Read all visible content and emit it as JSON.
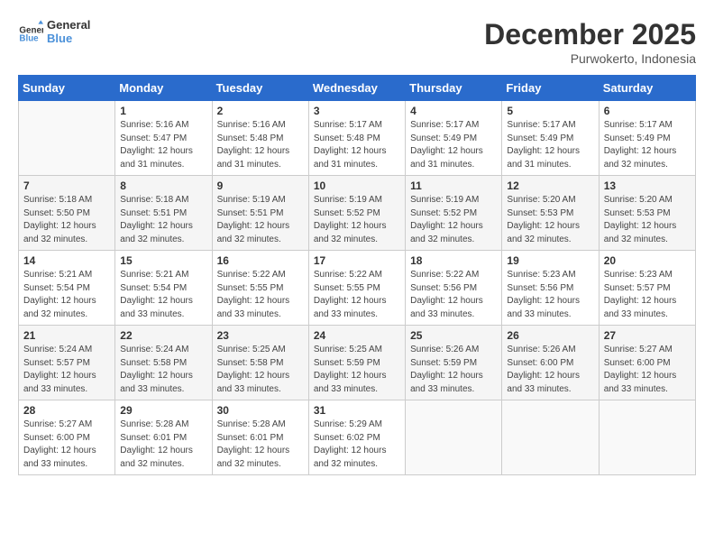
{
  "logo": {
    "line1": "General",
    "line2": "Blue"
  },
  "title": "December 2025",
  "location": "Purwokerto, Indonesia",
  "weekdays": [
    "Sunday",
    "Monday",
    "Tuesday",
    "Wednesday",
    "Thursday",
    "Friday",
    "Saturday"
  ],
  "weeks": [
    [
      {
        "day": "",
        "sunrise": "",
        "sunset": "",
        "daylight": ""
      },
      {
        "day": "1",
        "sunrise": "Sunrise: 5:16 AM",
        "sunset": "Sunset: 5:47 PM",
        "daylight": "Daylight: 12 hours and 31 minutes."
      },
      {
        "day": "2",
        "sunrise": "Sunrise: 5:16 AM",
        "sunset": "Sunset: 5:48 PM",
        "daylight": "Daylight: 12 hours and 31 minutes."
      },
      {
        "day": "3",
        "sunrise": "Sunrise: 5:17 AM",
        "sunset": "Sunset: 5:48 PM",
        "daylight": "Daylight: 12 hours and 31 minutes."
      },
      {
        "day": "4",
        "sunrise": "Sunrise: 5:17 AM",
        "sunset": "Sunset: 5:49 PM",
        "daylight": "Daylight: 12 hours and 31 minutes."
      },
      {
        "day": "5",
        "sunrise": "Sunrise: 5:17 AM",
        "sunset": "Sunset: 5:49 PM",
        "daylight": "Daylight: 12 hours and 31 minutes."
      },
      {
        "day": "6",
        "sunrise": "Sunrise: 5:17 AM",
        "sunset": "Sunset: 5:49 PM",
        "daylight": "Daylight: 12 hours and 32 minutes."
      }
    ],
    [
      {
        "day": "7",
        "sunrise": "Sunrise: 5:18 AM",
        "sunset": "Sunset: 5:50 PM",
        "daylight": "Daylight: 12 hours and 32 minutes."
      },
      {
        "day": "8",
        "sunrise": "Sunrise: 5:18 AM",
        "sunset": "Sunset: 5:51 PM",
        "daylight": "Daylight: 12 hours and 32 minutes."
      },
      {
        "day": "9",
        "sunrise": "Sunrise: 5:19 AM",
        "sunset": "Sunset: 5:51 PM",
        "daylight": "Daylight: 12 hours and 32 minutes."
      },
      {
        "day": "10",
        "sunrise": "Sunrise: 5:19 AM",
        "sunset": "Sunset: 5:52 PM",
        "daylight": "Daylight: 12 hours and 32 minutes."
      },
      {
        "day": "11",
        "sunrise": "Sunrise: 5:19 AM",
        "sunset": "Sunset: 5:52 PM",
        "daylight": "Daylight: 12 hours and 32 minutes."
      },
      {
        "day": "12",
        "sunrise": "Sunrise: 5:20 AM",
        "sunset": "Sunset: 5:53 PM",
        "daylight": "Daylight: 12 hours and 32 minutes."
      },
      {
        "day": "13",
        "sunrise": "Sunrise: 5:20 AM",
        "sunset": "Sunset: 5:53 PM",
        "daylight": "Daylight: 12 hours and 32 minutes."
      }
    ],
    [
      {
        "day": "14",
        "sunrise": "Sunrise: 5:21 AM",
        "sunset": "Sunset: 5:54 PM",
        "daylight": "Daylight: 12 hours and 32 minutes."
      },
      {
        "day": "15",
        "sunrise": "Sunrise: 5:21 AM",
        "sunset": "Sunset: 5:54 PM",
        "daylight": "Daylight: 12 hours and 33 minutes."
      },
      {
        "day": "16",
        "sunrise": "Sunrise: 5:22 AM",
        "sunset": "Sunset: 5:55 PM",
        "daylight": "Daylight: 12 hours and 33 minutes."
      },
      {
        "day": "17",
        "sunrise": "Sunrise: 5:22 AM",
        "sunset": "Sunset: 5:55 PM",
        "daylight": "Daylight: 12 hours and 33 minutes."
      },
      {
        "day": "18",
        "sunrise": "Sunrise: 5:22 AM",
        "sunset": "Sunset: 5:56 PM",
        "daylight": "Daylight: 12 hours and 33 minutes."
      },
      {
        "day": "19",
        "sunrise": "Sunrise: 5:23 AM",
        "sunset": "Sunset: 5:56 PM",
        "daylight": "Daylight: 12 hours and 33 minutes."
      },
      {
        "day": "20",
        "sunrise": "Sunrise: 5:23 AM",
        "sunset": "Sunset: 5:57 PM",
        "daylight": "Daylight: 12 hours and 33 minutes."
      }
    ],
    [
      {
        "day": "21",
        "sunrise": "Sunrise: 5:24 AM",
        "sunset": "Sunset: 5:57 PM",
        "daylight": "Daylight: 12 hours and 33 minutes."
      },
      {
        "day": "22",
        "sunrise": "Sunrise: 5:24 AM",
        "sunset": "Sunset: 5:58 PM",
        "daylight": "Daylight: 12 hours and 33 minutes."
      },
      {
        "day": "23",
        "sunrise": "Sunrise: 5:25 AM",
        "sunset": "Sunset: 5:58 PM",
        "daylight": "Daylight: 12 hours and 33 minutes."
      },
      {
        "day": "24",
        "sunrise": "Sunrise: 5:25 AM",
        "sunset": "Sunset: 5:59 PM",
        "daylight": "Daylight: 12 hours and 33 minutes."
      },
      {
        "day": "25",
        "sunrise": "Sunrise: 5:26 AM",
        "sunset": "Sunset: 5:59 PM",
        "daylight": "Daylight: 12 hours and 33 minutes."
      },
      {
        "day": "26",
        "sunrise": "Sunrise: 5:26 AM",
        "sunset": "Sunset: 6:00 PM",
        "daylight": "Daylight: 12 hours and 33 minutes."
      },
      {
        "day": "27",
        "sunrise": "Sunrise: 5:27 AM",
        "sunset": "Sunset: 6:00 PM",
        "daylight": "Daylight: 12 hours and 33 minutes."
      }
    ],
    [
      {
        "day": "28",
        "sunrise": "Sunrise: 5:27 AM",
        "sunset": "Sunset: 6:00 PM",
        "daylight": "Daylight: 12 hours and 33 minutes."
      },
      {
        "day": "29",
        "sunrise": "Sunrise: 5:28 AM",
        "sunset": "Sunset: 6:01 PM",
        "daylight": "Daylight: 12 hours and 32 minutes."
      },
      {
        "day": "30",
        "sunrise": "Sunrise: 5:28 AM",
        "sunset": "Sunset: 6:01 PM",
        "daylight": "Daylight: 12 hours and 32 minutes."
      },
      {
        "day": "31",
        "sunrise": "Sunrise: 5:29 AM",
        "sunset": "Sunset: 6:02 PM",
        "daylight": "Daylight: 12 hours and 32 minutes."
      },
      {
        "day": "",
        "sunrise": "",
        "sunset": "",
        "daylight": ""
      },
      {
        "day": "",
        "sunrise": "",
        "sunset": "",
        "daylight": ""
      },
      {
        "day": "",
        "sunrise": "",
        "sunset": "",
        "daylight": ""
      }
    ]
  ]
}
